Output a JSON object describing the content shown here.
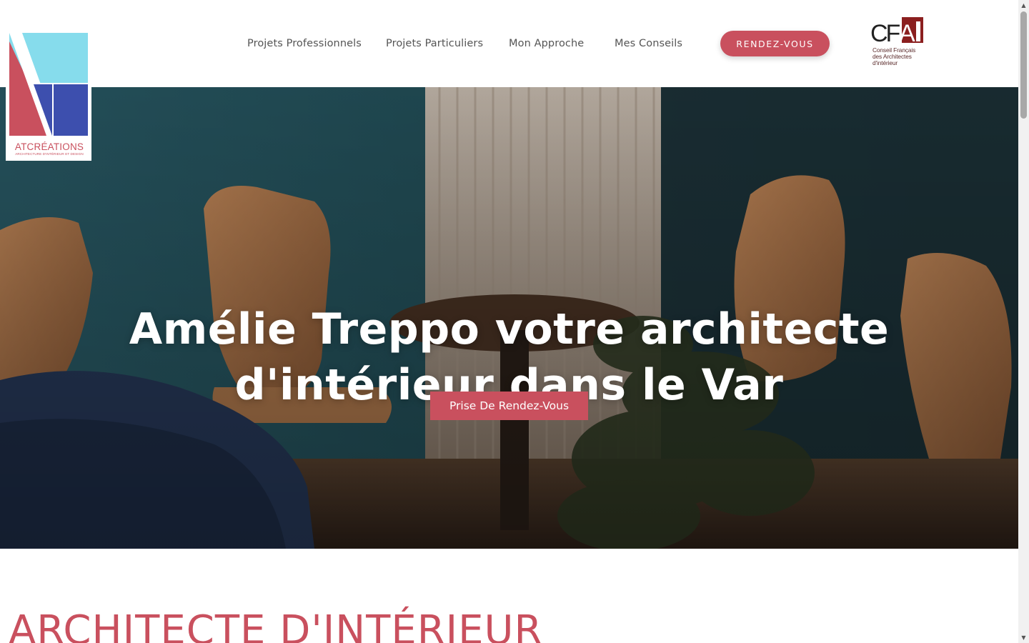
{
  "brand": {
    "logo_name": "ATCRÉATIONS",
    "logo_tagline": "ARCHITECTURE D'INTÉRIEUR ET DESIGN",
    "colors": {
      "accent": "#c9505e",
      "logo_blue": "#3d4fae",
      "logo_cyan": "#86dcec"
    }
  },
  "nav": {
    "items": [
      {
        "label": "Projets Professionnels"
      },
      {
        "label": "Projets Particuliers"
      },
      {
        "label": "Mon Approche"
      },
      {
        "label": "Mes Conseils"
      }
    ],
    "cta_label": "RENDEZ-VOUS"
  },
  "cfai": {
    "mark": "CFAI",
    "lines": [
      "Conseil Français",
      "des Architectes",
      "d'intérieur"
    ]
  },
  "hero": {
    "title_line1": "Amélie Treppo votre architecte",
    "title_line2": "d'intérieur dans le Var",
    "cta_label": "Prise De Rendez-Vous"
  },
  "section": {
    "title": "ARCHITECTE D'INTÉRIEUR"
  },
  "scrollbar": {
    "up_icon": "▲",
    "down_icon": "▼"
  }
}
